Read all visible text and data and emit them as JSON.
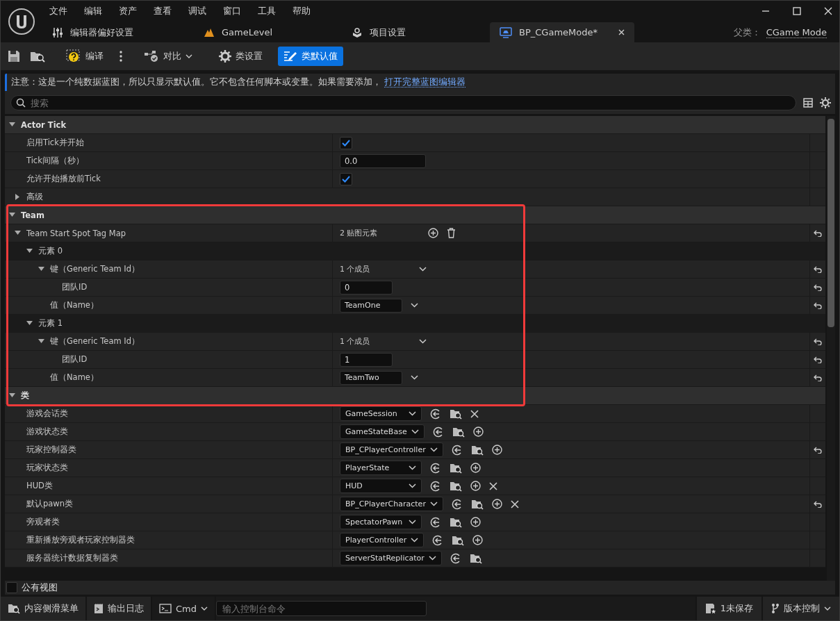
{
  "menu": [
    "文件",
    "编辑",
    "资产",
    "查看",
    "调试",
    "窗口",
    "工具",
    "帮助"
  ],
  "tabs": [
    {
      "label": "编辑器偏好设置",
      "kind": "settings",
      "selected": false
    },
    {
      "label": "GameLevel",
      "kind": "level",
      "selected": false
    },
    {
      "label": "项目设置",
      "kind": "project",
      "selected": false
    },
    {
      "label": "BP_CGameMode*",
      "kind": "blueprint",
      "selected": true
    }
  ],
  "parent_class": {
    "label": "父类：",
    "value": "CGame Mode"
  },
  "toolbar": [
    {
      "kind": "save"
    },
    {
      "kind": "browse"
    },
    {
      "kind": "compile",
      "label": "编译"
    },
    {
      "kind": "more"
    },
    {
      "kind": "diff",
      "label": "对比"
    },
    {
      "kind": "class-settings",
      "label": "类设置",
      "selected": false
    },
    {
      "kind": "class-defaults",
      "label": "类默认值",
      "selected": true
    }
  ],
  "notice": {
    "text": "注意：这是一个纯数据蓝图，所以只显示默认值。它不包含任何脚本或变量。如果需要添加，",
    "link": "打开完整蓝图编辑器"
  },
  "search": {
    "placeholder": "搜索"
  },
  "sections": [
    {
      "title": "Actor Tick",
      "expanded": true,
      "highlighted": false,
      "properties": [
        {
          "name": "启用Tick并开始",
          "kind": "checkbox",
          "checked": true,
          "reset": false
        },
        {
          "name": "Tick间隔（秒）",
          "kind": "number",
          "value": "0.0",
          "reset": false
        },
        {
          "name": "允许开始播放前Tick",
          "kind": "checkbox",
          "checked": true,
          "reset": false
        },
        {
          "name": "高级",
          "kind": "category",
          "expanded": false,
          "reset": false
        }
      ]
    },
    {
      "title": "Team",
      "expanded": true,
      "highlighted": true,
      "properties": [
        {
          "name": "Team Start Spot Tag Map",
          "kind": "map",
          "value": "2 贴图元素",
          "expanded": true,
          "reset": true,
          "children": [
            {
              "name": "元素 0",
              "kind": "element",
              "expanded": true,
              "reset": false,
              "children": [
                {
                  "name": "键（Generic Team Id）",
                  "kind": "struct",
                  "value": "1 个成员",
                  "expanded": true,
                  "reset": true,
                  "children": [
                    {
                      "name": "团队ID",
                      "kind": "number",
                      "value": "0",
                      "reset": true
                    }
                  ]
                },
                {
                  "name": "值（Name）",
                  "kind": "name",
                  "value": "TeamOne",
                  "reset": true
                }
              ]
            },
            {
              "name": "元素 1",
              "kind": "element",
              "expanded": true,
              "reset": false,
              "children": [
                {
                  "name": "键（Generic Team Id）",
                  "kind": "struct",
                  "value": "1 个成员",
                  "expanded": true,
                  "reset": true,
                  "children": [
                    {
                      "name": "团队ID",
                      "kind": "number",
                      "value": "1",
                      "reset": true
                    }
                  ]
                },
                {
                  "name": "值（Name）",
                  "kind": "name",
                  "value": "TeamTwo",
                  "reset": true
                }
              ]
            }
          ]
        }
      ]
    },
    {
      "title": "类",
      "expanded": true,
      "highlighted": false,
      "properties": [
        {
          "name": "游戏会话类",
          "kind": "class",
          "value": "GameSession",
          "addable": false,
          "clearable": true,
          "reset": false
        },
        {
          "name": "游戏状态类",
          "kind": "class",
          "value": "GameStateBase",
          "addable": true,
          "clearable": false,
          "reset": false
        },
        {
          "name": "玩家控制器类",
          "kind": "class",
          "value": "BP_CPlayerController",
          "addable": true,
          "clearable": false,
          "reset": true
        },
        {
          "name": "玩家状态类",
          "kind": "class",
          "value": "PlayerState",
          "addable": true,
          "clearable": false,
          "reset": false
        },
        {
          "name": "HUD类",
          "kind": "class",
          "value": "HUD",
          "addable": true,
          "clearable": true,
          "reset": false
        },
        {
          "name": "默认pawn类",
          "kind": "class",
          "value": "BP_CPlayerCharacter",
          "addable": true,
          "clearable": true,
          "reset": true
        },
        {
          "name": "旁观者类",
          "kind": "class",
          "value": "SpectatorPawn",
          "addable": true,
          "clearable": false,
          "reset": false
        },
        {
          "name": "重新播放旁观者玩家控制器类",
          "kind": "class",
          "value": "PlayerController",
          "addable": true,
          "clearable": false,
          "reset": false
        },
        {
          "name": "服务器统计数据复制器类",
          "kind": "class",
          "value": "ServerStatReplicator",
          "addable": false,
          "clearable": false,
          "reset": false
        }
      ]
    }
  ],
  "public_view": {
    "label": "公有视图",
    "checked": false
  },
  "status_bar": {
    "content_drawer": "内容侧滑菜单",
    "output_log": "输出日志",
    "cmd": "Cmd",
    "console_placeholder": "输入控制台命令",
    "unsaved": "1未保存",
    "source_control": "版本控制"
  }
}
